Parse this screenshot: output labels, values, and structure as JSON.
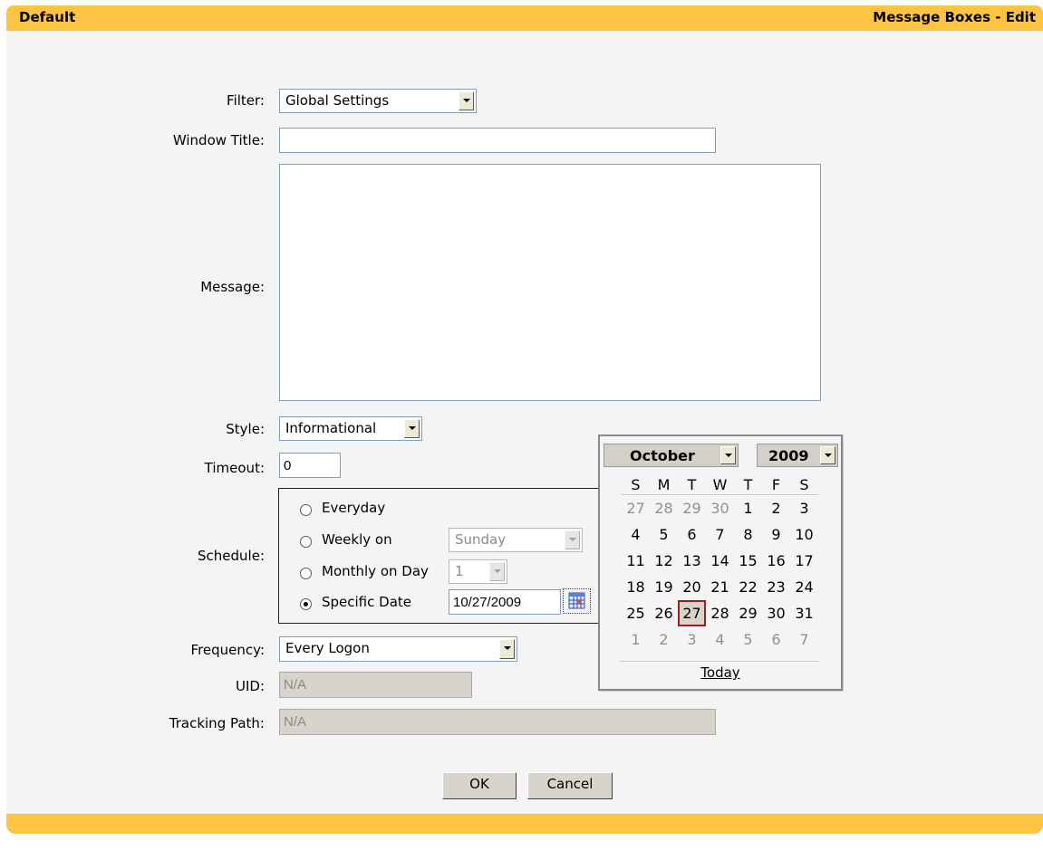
{
  "header": {
    "left_title": "Default",
    "right_title": "Message Boxes - Edit"
  },
  "form": {
    "filter_label": "Filter:",
    "filter_value": "Global Settings",
    "window_title_label": "Window Title:",
    "window_title_value": "",
    "message_label": "Message:",
    "message_value": "",
    "style_label": "Style:",
    "style_value": "Informational",
    "timeout_label": "Timeout:",
    "timeout_value": "0",
    "schedule_label": "Schedule:",
    "schedule_options": {
      "everyday": "Everyday",
      "weekly": "Weekly on",
      "monthly": "Monthly on Day",
      "specific": "Specific Date"
    },
    "schedule_selected": "specific",
    "weekly_day_value": "Sunday",
    "monthly_day_value": "1",
    "specific_date_value": "10/27/2009",
    "frequency_label": "Frequency:",
    "frequency_value": "Every Logon",
    "uid_label": "UID:",
    "uid_value": "N/A",
    "tracking_label": "Tracking Path:",
    "tracking_value": "N/A"
  },
  "buttons": {
    "ok": "OK",
    "cancel": "Cancel"
  },
  "calendar": {
    "month": "October",
    "year": "2009",
    "weekdays": [
      "S",
      "M",
      "T",
      "W",
      "T",
      "F",
      "S"
    ],
    "weeks": [
      [
        "27",
        "28",
        "29",
        "30",
        "1",
        "2",
        "3"
      ],
      [
        "4",
        "5",
        "6",
        "7",
        "8",
        "9",
        "10"
      ],
      [
        "11",
        "12",
        "13",
        "14",
        "15",
        "16",
        "17"
      ],
      [
        "18",
        "19",
        "20",
        "21",
        "22",
        "23",
        "24"
      ],
      [
        "25",
        "26",
        "27",
        "28",
        "29",
        "30",
        "31"
      ],
      [
        "1",
        "2",
        "3",
        "4",
        "5",
        "6",
        "7"
      ]
    ],
    "selected_day": "27",
    "today_label": "Today"
  },
  "icons": {
    "calendar": "calendar-icon",
    "dropdown": "chevron-down-icon"
  },
  "colors": {
    "header": "#fdc443",
    "panel": "#f4f4f4"
  }
}
